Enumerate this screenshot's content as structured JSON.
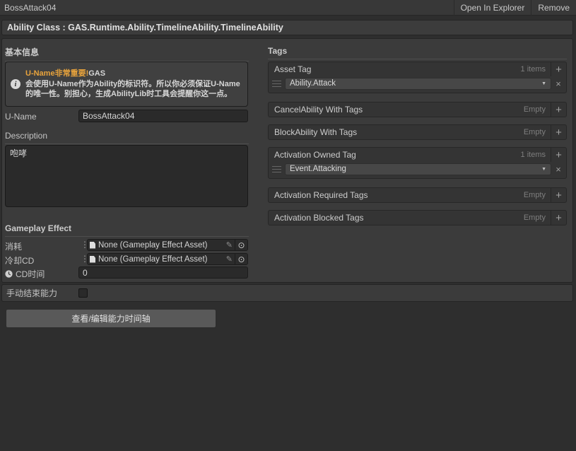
{
  "colors": {
    "warning_orange": "#e8a33c",
    "panel_bg": "#3b3b3b",
    "page_bg": "#2e2e2e",
    "field_bg": "#2a2a2a",
    "dropdown_bg": "#474747"
  },
  "titlebar": {
    "title": "BossAttack04",
    "open_button": "Open In Explorer",
    "remove_button": "Remove"
  },
  "ability_class_line": "Ability Class : GAS.Runtime.Ability.TimelineAbility.TimelineAbility",
  "basic_info": {
    "section_title": "基本信息",
    "notice": {
      "highlight": "U-Name非常重要!",
      "title_rest": "GAS",
      "body": "会使用U-Name作为Ability的标识符。所以你必须保证U-Name的唯一性。别担心，生成AbilityLib时工具会提醒你这一点。"
    },
    "u_name": {
      "label": "U-Name",
      "value": "BossAttack04"
    },
    "description": {
      "label": "Description",
      "value": "咆哮"
    }
  },
  "gameplay_effect": {
    "section_title": "Gameplay Effect",
    "rows": [
      {
        "label": "消耗",
        "value": "None (Gameplay Effect Asset)"
      },
      {
        "label": "冷却CD",
        "value": "None (Gameplay Effect Asset)"
      }
    ],
    "cd_time": {
      "label": "CD时间",
      "value": "0"
    }
  },
  "tags": {
    "section_title": "Tags",
    "groups": [
      {
        "label": "Asset Tag",
        "count": "1 items",
        "items": [
          "Ability.Attack"
        ]
      },
      {
        "label": "CancelAbility With Tags",
        "count": "Empty",
        "items": []
      },
      {
        "label": "BlockAbility With Tags",
        "count": "Empty",
        "items": []
      },
      {
        "label": "Activation Owned Tag",
        "count": "1 items",
        "items": [
          "Event.Attacking"
        ]
      },
      {
        "label": "Activation Required Tags",
        "count": "Empty",
        "items": []
      },
      {
        "label": "Activation Blocked Tags",
        "count": "Empty",
        "items": []
      }
    ]
  },
  "footer": {
    "manual_end_label": "手动结束能力",
    "timeline_button": "查看/编辑能力时间轴"
  },
  "icons": {
    "plus": "+",
    "close": "×",
    "dropdown_arrow": "▼",
    "more_dots": "⋮",
    "pencil": "✎",
    "picker": "⊙",
    "info": "i"
  }
}
